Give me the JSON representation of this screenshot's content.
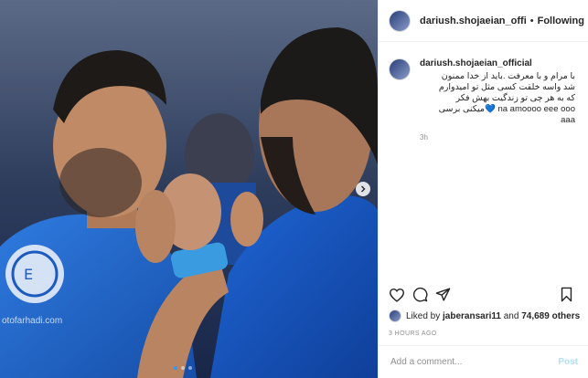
{
  "post": {
    "photo": {
      "alt": "Two football players in blue kits celebrating",
      "watermark": "otofarhadi.com",
      "slide_count": 3,
      "active_slide": 0,
      "next_icon": "chevron-right-icon"
    },
    "header": {
      "username": "dariush.shojaeian_offi",
      "separator": "•",
      "follow_label": "Following"
    },
    "caption": {
      "username": "dariush.shojaeian_official",
      "text": "با مرام و با معرفت .باید از خدا ممنون\nشد واسه خلقت کسی مثل تو امیدوارم\nکه به هر چی تو زندگیت بهش فکر\nna amoooo eee ooo 💙میکنی برسی\naaa",
      "time": "3h"
    },
    "actions": {
      "like_icon": "heart-icon",
      "comment_icon": "comment-icon",
      "share_icon": "share-icon",
      "save_icon": "bookmark-icon"
    },
    "likes": {
      "prefix": "Liked by",
      "user": "jaberansari11",
      "connector": "and",
      "count": "74,689 others"
    },
    "posted_ago": "3 HOURS AGO",
    "comment_box": {
      "placeholder": "Add a comment...",
      "post_label": "Post"
    }
  },
  "colors": {
    "accent": "#3897f0",
    "post_disabled": "#b2dffc",
    "kit_blue": "#1f5fc8",
    "border": "#efefef"
  }
}
